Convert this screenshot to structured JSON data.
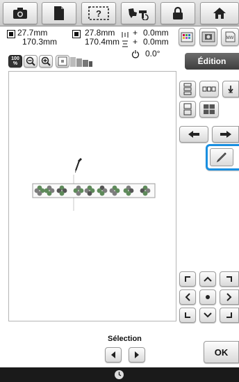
{
  "toolbar": {
    "buttons": [
      {
        "name": "camera-button",
        "icon": "camera-icon"
      },
      {
        "name": "file-button",
        "icon": "document-icon"
      },
      {
        "name": "help-button",
        "icon": "help-icon"
      },
      {
        "name": "embroidery-button",
        "icon": "embroidery-machine-icon"
      },
      {
        "name": "lock-button",
        "icon": "lock-icon"
      },
      {
        "name": "home-button",
        "icon": "home-icon"
      }
    ]
  },
  "info": {
    "width_1": "27.7mm",
    "height_1": "170.3mm",
    "width_2": "27.8mm",
    "height_2": "170.4mm",
    "offset_x_sign": "+",
    "offset_x": "0.0mm",
    "offset_y_sign": "+",
    "offset_y": "0.0mm",
    "rotation": "0.0°"
  },
  "zoom": {
    "level_label": "100",
    "level_unit": "%"
  },
  "tabs": {
    "edit_label": "Édition"
  },
  "navigation": {
    "selection_label": "Sélection",
    "ok_label": "OK"
  },
  "colors": {
    "accent_highlight": "#1a8fe0",
    "leaf_green": "#5e8a5a",
    "leaf_gray": "#7d7d7d"
  }
}
